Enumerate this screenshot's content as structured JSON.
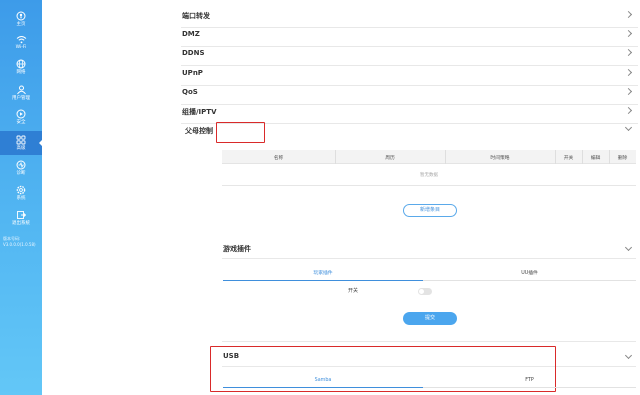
{
  "sidebar": {
    "items": [
      {
        "label": "主页",
        "icon": "home-icon"
      },
      {
        "label": "Wi-Fi",
        "icon": "wifi-icon"
      },
      {
        "label": "网络",
        "icon": "globe-icon"
      },
      {
        "label": "用户管理",
        "icon": "users-icon"
      },
      {
        "label": "安全",
        "icon": "shield-icon"
      },
      {
        "label": "高级",
        "icon": "grid-icon"
      },
      {
        "label": "诊断",
        "icon": "diagnostic-icon"
      },
      {
        "label": "系统",
        "icon": "gear-icon"
      },
      {
        "label": "退出系统",
        "icon": "logout-icon"
      }
    ],
    "active_index": 5,
    "version_lines": [
      "版本号码:",
      "V3.0.0.0(1.0.58)"
    ]
  },
  "settings_rows": [
    {
      "label": "端口转发"
    },
    {
      "label": "DMZ"
    },
    {
      "label": "DDNS"
    },
    {
      "label": "UPnP"
    },
    {
      "label": "QoS"
    },
    {
      "label": "组播/IPTV"
    }
  ],
  "parental": {
    "title": "父母控制",
    "columns": [
      "名称",
      "周历",
      "时间策略",
      "开关",
      "编辑",
      "删除"
    ],
    "empty_text": "暂无数据",
    "add_button": "新增条目"
  },
  "game_plugin": {
    "title": "游戏插件",
    "tabs": [
      "玩家插件",
      "UU插件"
    ],
    "active_tab": 0,
    "switch_label": "开关",
    "switch_on": false,
    "submit_button": "提交"
  },
  "usb": {
    "title": "USB",
    "tabs": [
      "Samba",
      "FTP"
    ],
    "active_tab": 0
  },
  "colors": {
    "accent": "#3f8fdc",
    "highlight_box": "#d92a2a",
    "sidebar_top": "#3d9be9",
    "sidebar_bottom": "#63c7f7"
  }
}
